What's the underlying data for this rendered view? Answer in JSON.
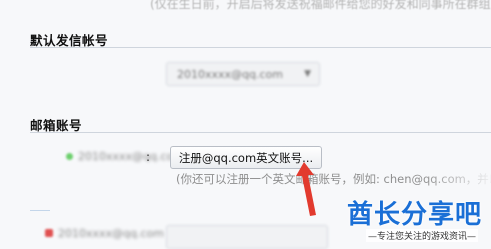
{
  "top_note": "(仅在生日前，开启后将发送祝福邮件给您的好友和同事所在群组)",
  "default_sender": {
    "title": "默认发信帐号",
    "account_value": "2010xxxx@qq.com"
  },
  "mailbox_accounts": {
    "title": "邮箱账号",
    "qq_label": "2010xxxx@qq.com",
    "colon": ":",
    "register_button": "注册@qq.com英文账号...",
    "hint": "(你还可以注册一个英文邮箱账号，例如: chen@qq.com，并以此",
    "second_account_value": "2010xxxx@qq.com"
  },
  "watermark": {
    "brand": "酋长分享吧",
    "tagline": "—专注您关注的游戏资讯—"
  },
  "colors": {
    "arrow": "#e23a2e",
    "watermark_blue": "#1a6fd6",
    "background": "#f7f8fa"
  },
  "icons": {
    "status_dot": "green-status-dot-icon",
    "annotation": "red-arrow-icon"
  }
}
